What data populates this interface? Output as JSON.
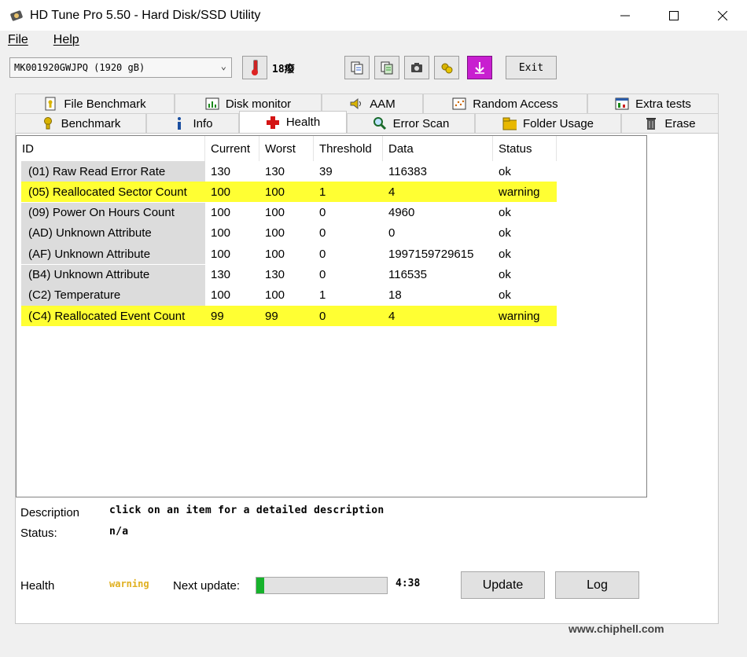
{
  "window": {
    "title": "HD Tune Pro 5.50 - Hard Disk/SSD Utility"
  },
  "menu": {
    "file": "File",
    "help": "Help"
  },
  "toolbar": {
    "drive": "MK001920GWJPQ (1920 gB)",
    "temperature": "18癈",
    "exit_label": "Exit"
  },
  "tabs": {
    "row1": [
      {
        "label": "File Benchmark",
        "icon": "file-benchmark-icon"
      },
      {
        "label": "Disk monitor",
        "icon": "disk-monitor-icon"
      },
      {
        "label": "AAM",
        "icon": "speaker-icon"
      },
      {
        "label": "Random Access",
        "icon": "random-access-icon"
      },
      {
        "label": "Extra tests",
        "icon": "extra-tests-icon"
      }
    ],
    "row2": [
      {
        "label": "Benchmark",
        "icon": "benchmark-icon"
      },
      {
        "label": "Info",
        "icon": "info-icon"
      },
      {
        "label": "Health",
        "icon": "health-cross-icon"
      },
      {
        "label": "Error Scan",
        "icon": "magnifier-icon"
      },
      {
        "label": "Folder Usage",
        "icon": "folder-icon"
      },
      {
        "label": "Erase",
        "icon": "trash-icon"
      }
    ]
  },
  "table": {
    "headers": [
      "ID",
      "Current",
      "Worst",
      "Threshold",
      "Data",
      "Status"
    ],
    "rows": [
      {
        "id": "(01) Raw Read Error Rate",
        "current": "130",
        "worst": "130",
        "threshold": "39",
        "data": "116383",
        "status": "ok",
        "warn": false
      },
      {
        "id": "(05) Reallocated Sector Count",
        "current": "100",
        "worst": "100",
        "threshold": "1",
        "data": "4",
        "status": "warning",
        "warn": true
      },
      {
        "id": "(09) Power On Hours Count",
        "current": "100",
        "worst": "100",
        "threshold": "0",
        "data": "4960",
        "status": "ok",
        "warn": false
      },
      {
        "id": "(AD) Unknown Attribute",
        "current": "100",
        "worst": "100",
        "threshold": "0",
        "data": "0",
        "status": "ok",
        "warn": false
      },
      {
        "id": "(AF) Unknown Attribute",
        "current": "100",
        "worst": "100",
        "threshold": "0",
        "data": "1997159729615",
        "status": "ok",
        "warn": false
      },
      {
        "id": "(B4) Unknown Attribute",
        "current": "130",
        "worst": "130",
        "threshold": "0",
        "data": "116535",
        "status": "ok",
        "warn": false
      },
      {
        "id": "(C2) Temperature",
        "current": "100",
        "worst": "100",
        "threshold": "1",
        "data": "18",
        "status": "ok",
        "warn": false
      },
      {
        "id": "(C4) Reallocated Event Count",
        "current": "99",
        "worst": "99",
        "threshold": "0",
        "data": "4",
        "status": "warning",
        "warn": true
      }
    ]
  },
  "details": {
    "description_label": "Description",
    "description_value": "click on an item for a detailed description",
    "status_label": "Status:",
    "status_value": "n/a"
  },
  "footer": {
    "health_label": "Health",
    "health_value": "warning",
    "next_update_label": "Next update:",
    "progress_fraction": 0.06,
    "countdown": "4:38",
    "update_label": "Update",
    "log_label": "Log"
  },
  "watermark": {
    "url": "www.chiphell.com"
  },
  "colors": {
    "warning_row": "#ffff33",
    "progress": "#16b22b",
    "health_warning_text": "#e0b020"
  }
}
